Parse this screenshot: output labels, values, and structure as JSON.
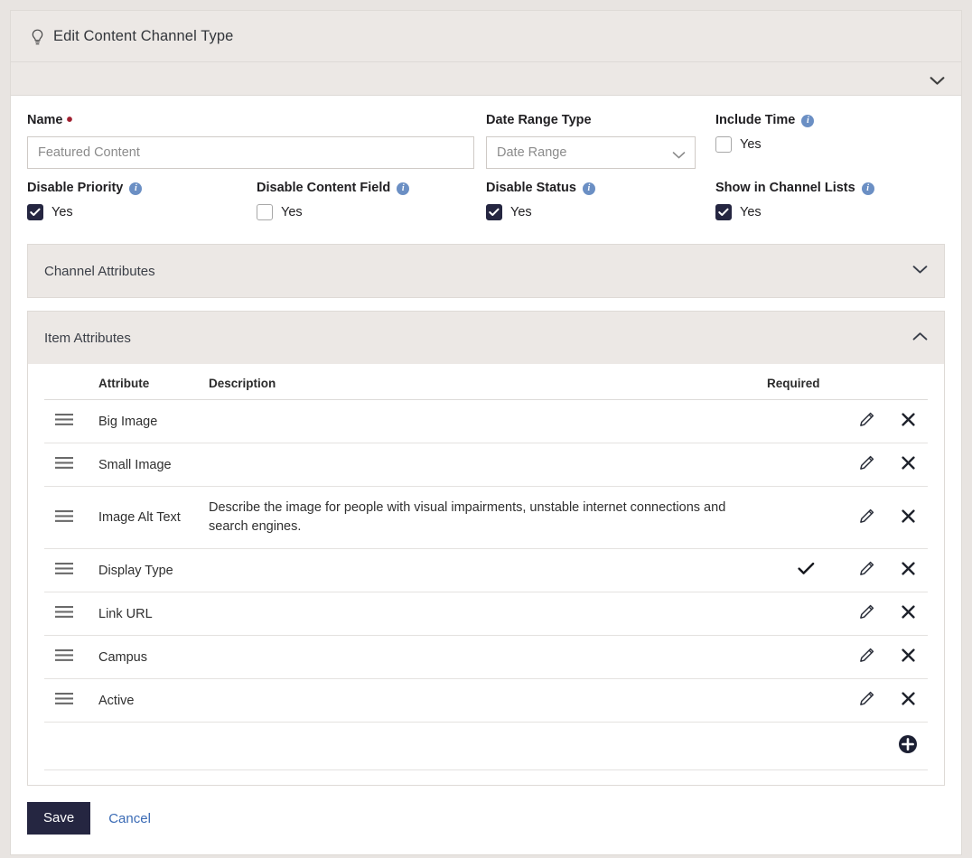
{
  "header": {
    "title": "Edit Content Channel Type",
    "icon": "lightbulb-icon",
    "collapse_icon": "chevron-down-icon"
  },
  "form": {
    "name": {
      "label": "Name",
      "required_marker": "•",
      "value": "",
      "placeholder": "Featured Content"
    },
    "date_range_type": {
      "label": "Date Range Type",
      "selected": "Date Range"
    },
    "include_time": {
      "label": "Include Time",
      "checkbox_label": "Yes",
      "checked": false
    },
    "disable_priority": {
      "label": "Disable Priority",
      "checkbox_label": "Yes",
      "checked": true
    },
    "disable_content_field": {
      "label": "Disable Content Field",
      "checkbox_label": "Yes",
      "checked": false
    },
    "disable_status": {
      "label": "Disable Status",
      "checkbox_label": "Yes",
      "checked": true
    },
    "show_in_channel_lists": {
      "label": "Show in Channel Lists",
      "checkbox_label": "Yes",
      "checked": true
    }
  },
  "channel_attributes_panel": {
    "title": "Channel Attributes",
    "expanded": false,
    "toggle_icon": "chevron-down-icon"
  },
  "item_attributes_panel": {
    "title": "Item Attributes",
    "expanded": true,
    "toggle_icon": "chevron-up-icon",
    "columns": {
      "handle": "",
      "attribute": "Attribute",
      "description": "Description",
      "required": "Required"
    },
    "rows": [
      {
        "attribute": "Big Image",
        "description": "",
        "required": false
      },
      {
        "attribute": "Small Image",
        "description": "",
        "required": false
      },
      {
        "attribute": "Image Alt Text",
        "description": "Describe the image for people with visual impairments, unstable internet connections and search engines.",
        "required": false
      },
      {
        "attribute": "Display Type",
        "description": "",
        "required": true
      },
      {
        "attribute": "Link URL",
        "description": "",
        "required": false
      },
      {
        "attribute": "Campus",
        "description": "",
        "required": false
      },
      {
        "attribute": "Active",
        "description": "",
        "required": false
      }
    ],
    "row_icons": {
      "handle": "drag-handle-icon",
      "edit": "pencil-icon",
      "delete": "close-icon",
      "required_check": "check-icon"
    },
    "add_button_icon": "plus-circle-icon"
  },
  "footer": {
    "save_label": "Save",
    "cancel_label": "Cancel"
  },
  "colors": {
    "page_background": "#e8e4e1",
    "panel_header": "#ece8e5",
    "accent_dark": "#252641",
    "link": "#3b6bb5",
    "info_icon": "#6b8fc4",
    "required_dot": "#a02030"
  }
}
